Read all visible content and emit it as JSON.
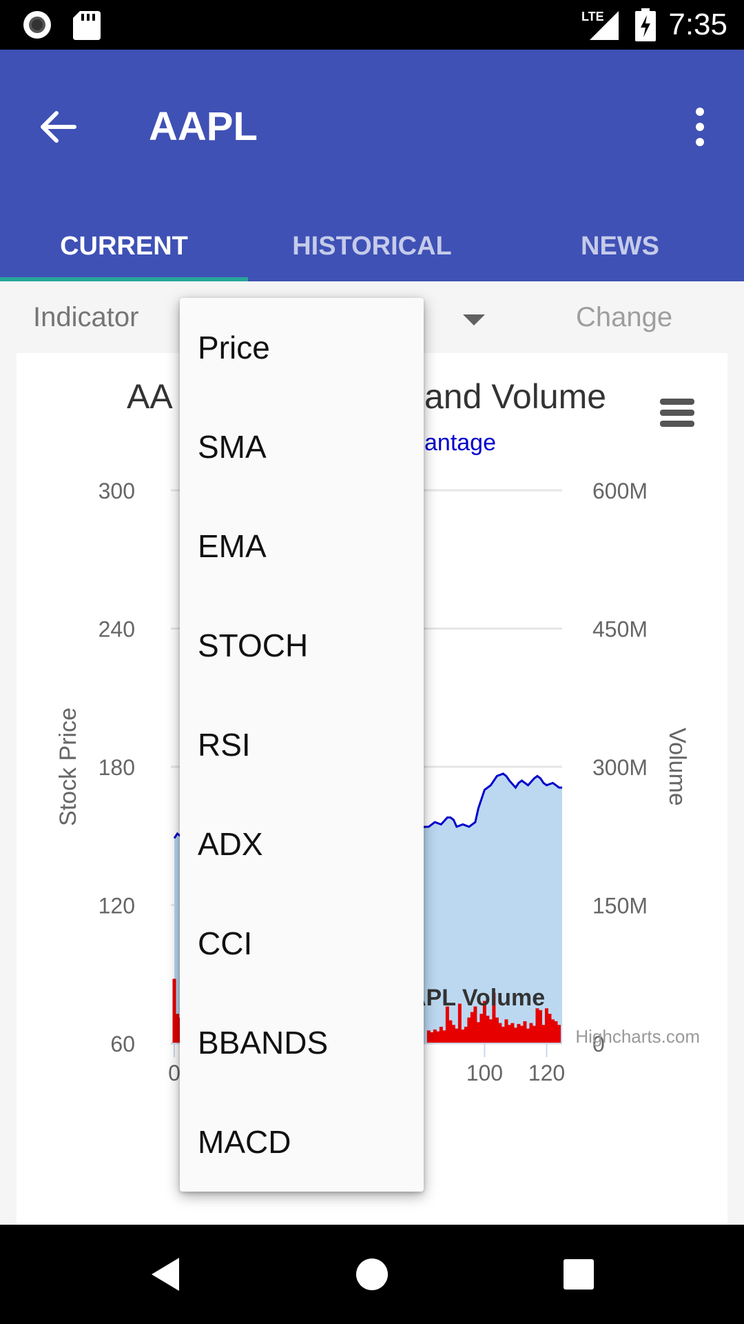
{
  "status_bar": {
    "time": "7:35",
    "network_label": "LTE",
    "icons": [
      "record-icon",
      "sd-card-icon",
      "lte-signal-icon",
      "battery-charging-icon"
    ]
  },
  "app_bar": {
    "title": "AAPL",
    "back_icon": "arrow-left-icon",
    "menu_icon": "more-vert-icon",
    "colors": {
      "primary": "#3f51b5",
      "tab_indicator": "#26a69a"
    }
  },
  "tabs": [
    {
      "label": "CURRENT",
      "active": true
    },
    {
      "label": "HISTORICAL",
      "active": false
    },
    {
      "label": "NEWS",
      "active": false
    }
  ],
  "controls": {
    "indicator_label": "Indicator",
    "change_label": "Change"
  },
  "dropdown": {
    "options": [
      "Price",
      "SMA",
      "EMA",
      "STOCH",
      "RSI",
      "ADX",
      "CCI",
      "BBANDS",
      "MACD"
    ]
  },
  "chart_data": {
    "type": "area",
    "title_visible_left": "AA",
    "title_visible_right": "and Volume",
    "subtitle_visible": "antage",
    "legend_visible": "APL Volume",
    "credits": "Highcharts.com",
    "menu_icon": "hamburger-menu-icon",
    "y_left": {
      "label": "Stock Price",
      "ticks": [
        "300",
        "240",
        "180",
        "120",
        "60"
      ],
      "range": [
        60,
        300
      ]
    },
    "y_right": {
      "label": "Volume",
      "ticks": [
        "600M",
        "450M",
        "300M",
        "150M",
        "0"
      ],
      "range": [
        0,
        600000000
      ]
    },
    "x": {
      "ticks_visible": [
        "0",
        "100",
        "120"
      ],
      "range": [
        0,
        125
      ]
    },
    "series": [
      {
        "name": "Price",
        "color": "#0000cc",
        "fill": "#bbd8f0",
        "points": [
          [
            0,
            149
          ],
          [
            1,
            151
          ],
          [
            2,
            150
          ],
          [
            82,
            154
          ],
          [
            84,
            156
          ],
          [
            86,
            155
          ],
          [
            88,
            158
          ],
          [
            89,
            158
          ],
          [
            90,
            157
          ],
          [
            91,
            154
          ],
          [
            93,
            155
          ],
          [
            95,
            154
          ],
          [
            97,
            156
          ],
          [
            98,
            162
          ],
          [
            100,
            170
          ],
          [
            102,
            172
          ],
          [
            104,
            176
          ],
          [
            106,
            177
          ],
          [
            107,
            176
          ],
          [
            108,
            174
          ],
          [
            110,
            171
          ],
          [
            111,
            173
          ],
          [
            112,
            174
          ],
          [
            114,
            172
          ],
          [
            116,
            175
          ],
          [
            117,
            176
          ],
          [
            118,
            175
          ],
          [
            119,
            173
          ],
          [
            120,
            172
          ],
          [
            122,
            173
          ],
          [
            123,
            172
          ],
          [
            124,
            171
          ],
          [
            125,
            171
          ]
        ]
      },
      {
        "name": "Volume",
        "color": "#e60000",
        "points": [
          [
            0,
            70
          ],
          [
            1,
            32
          ],
          [
            2,
            28
          ],
          [
            82,
            14
          ],
          [
            83,
            12
          ],
          [
            84,
            15
          ],
          [
            85,
            13
          ],
          [
            86,
            18
          ],
          [
            87,
            14
          ],
          [
            88,
            40
          ],
          [
            89,
            25
          ],
          [
            90,
            20
          ],
          [
            91,
            16
          ],
          [
            92,
            43
          ],
          [
            93,
            15
          ],
          [
            94,
            18
          ],
          [
            95,
            28
          ],
          [
            96,
            34
          ],
          [
            97,
            40
          ],
          [
            98,
            23
          ],
          [
            99,
            32
          ],
          [
            100,
            46
          ],
          [
            101,
            30
          ],
          [
            102,
            26
          ],
          [
            103,
            55
          ],
          [
            104,
            28
          ],
          [
            105,
            22
          ],
          [
            106,
            18
          ],
          [
            107,
            26
          ],
          [
            108,
            20
          ],
          [
            109,
            22
          ],
          [
            110,
            17
          ],
          [
            111,
            21
          ],
          [
            112,
            19
          ],
          [
            113,
            24
          ],
          [
            114,
            16
          ],
          [
            115,
            22
          ],
          [
            116,
            19
          ],
          [
            117,
            38
          ],
          [
            118,
            36
          ],
          [
            119,
            20
          ],
          [
            120,
            38
          ],
          [
            121,
            32
          ],
          [
            122,
            26
          ],
          [
            123,
            24
          ],
          [
            124,
            20
          ]
        ]
      }
    ]
  }
}
